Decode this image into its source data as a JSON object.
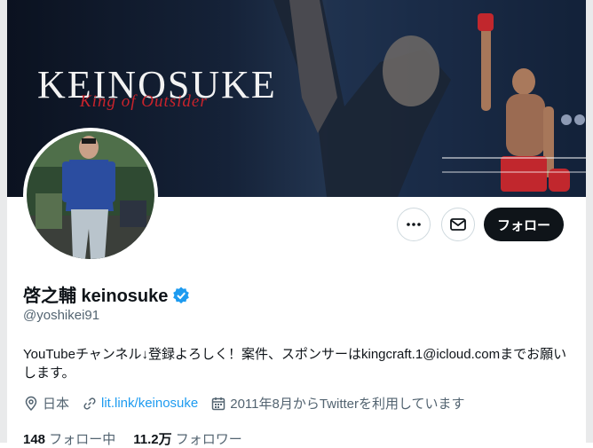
{
  "banner": {
    "title": "KEINOSUKE",
    "subtitle": "King of Outsider"
  },
  "actions": {
    "more_icon": "more-horizontal-icon",
    "mail_icon": "mail-icon",
    "follow_label": "フォロー"
  },
  "profile": {
    "display_name": "啓之輔 keinosuke",
    "handle": "@yoshikei91",
    "bio": "YouTubeチャンネル↓登録よろしく！案件、スポンサーはkingcraft.1@icloud.comまでお願いします。",
    "location": "日本",
    "link": "lit.link/keinosuke",
    "joined": "2011年8月からTwitterを利用しています"
  },
  "stats": {
    "following_count": "148",
    "following_label": "フォロー中",
    "followers_count": "11.2万",
    "followers_label": "フォロワー"
  },
  "colors": {
    "verified": "#1d9bf0",
    "link": "#1d9bf0",
    "follow_bg": "#0f1419",
    "secondary_text": "#536471"
  }
}
